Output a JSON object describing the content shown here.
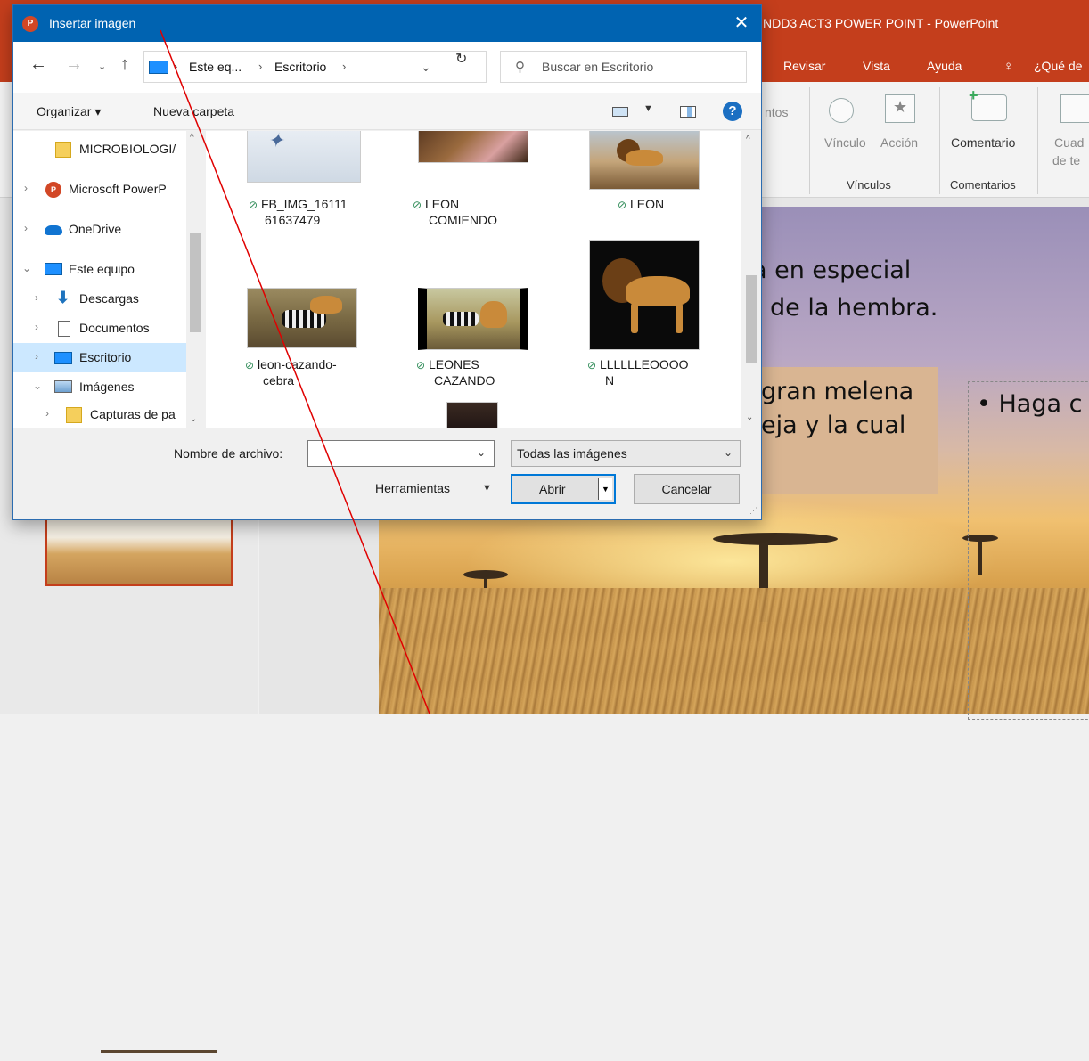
{
  "powerpoint": {
    "window_title": "NDD3 ACT3 POWER POINT  -  PowerPoint",
    "menu_tabs": [
      "Revisar",
      "Vista",
      "Ayuda",
      "¿Qué de"
    ],
    "ribbon": {
      "partial_text": "ntos",
      "buttons": [
        "Vínculo",
        "Acción",
        "Comentario",
        "Cuad",
        "de te"
      ],
      "groups": [
        "Vínculos",
        "Comentarios"
      ]
    },
    "slide": {
      "line1": "a en especial",
      "line2": "de la hembra.",
      "box_line1": "gran melena",
      "box_line2": "eja y la cual",
      "placeholder_text": "• Haga c"
    }
  },
  "dialog": {
    "title": "Insertar imagen",
    "close_glyph": "✕",
    "address": {
      "crumbs": [
        "Este eq...",
        "Escritorio"
      ],
      "separator": "›"
    },
    "search": {
      "placeholder": "Buscar en Escritorio"
    },
    "toolbar": {
      "organize": "Organizar ▾",
      "new_folder": "Nueva carpeta"
    },
    "nav_tree": [
      {
        "label": "MICROBIOLOGI/",
        "icon": "folder-icon"
      },
      {
        "label": "Microsoft PowerP",
        "icon": "powerpoint-icon"
      },
      {
        "label": "OneDrive",
        "icon": "onedrive-icon"
      },
      {
        "label": "Este equipo",
        "icon": "computer-icon"
      },
      {
        "label": "Descargas",
        "icon": "download-icon"
      },
      {
        "label": "Documentos",
        "icon": "document-icon"
      },
      {
        "label": "Escritorio",
        "icon": "desktop-icon",
        "selected": true
      },
      {
        "label": "Imágenes",
        "icon": "pictures-icon"
      },
      {
        "label": "Capturas de pa",
        "icon": "folder-icon"
      }
    ],
    "files": [
      {
        "line1": "FB_IMG_16111",
        "line2": "61637479"
      },
      {
        "line1": "LEON",
        "line2": "COMIENDO"
      },
      {
        "line1": "LEON",
        "line2": ""
      },
      {
        "line1": "leon-cazando-",
        "line2": "cebra"
      },
      {
        "line1": "LEONES",
        "line2": "CAZANDO"
      },
      {
        "line1": "LLLLLLEOOOO",
        "line2": "N"
      }
    ],
    "filename_label": "Nombre de archivo:",
    "filename_value": "",
    "filter": "Todas las imágenes",
    "tools": "Herramientas",
    "open": "Abrir",
    "cancel": "Cancelar"
  }
}
